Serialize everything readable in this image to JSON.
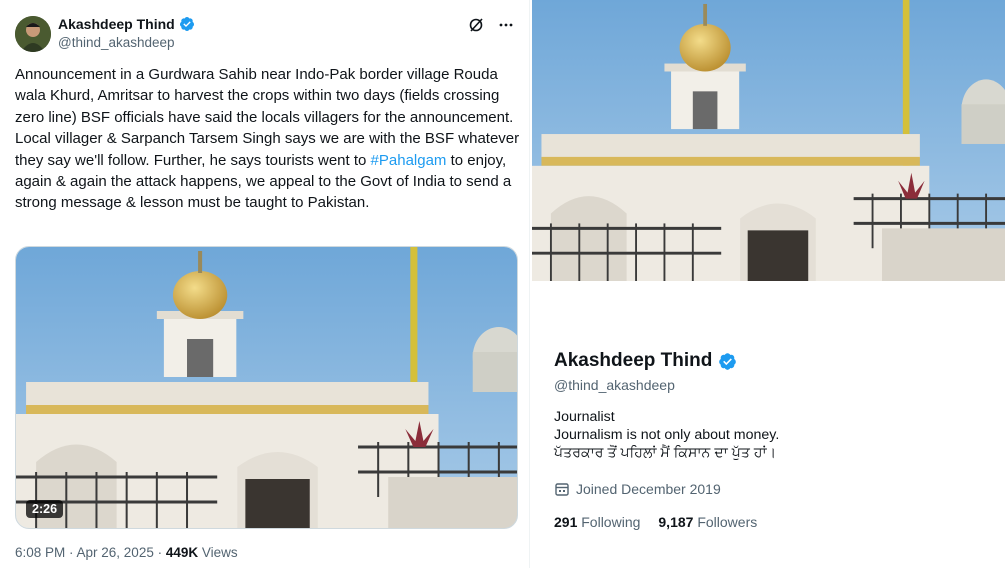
{
  "tweet": {
    "author_name": "Akashdeep Thind",
    "author_handle": "@thind_akashdeep",
    "text_before": "Announcement in a Gurdwara Sahib near Indo-Pak border village Rouda wala Khurd, Amritsar to harvest the crops within two days (fields crossing zero line) BSF officials have said the locals villagers for the announcement. Local villager & Sarpanch Tarsem Singh says we are with the BSF whatever they say we'll follow. Further, he says tourists went to ",
    "hashtag": "#Pahalgam",
    "text_after": " to enjoy, again & again the attack happens, we appeal to the Govt of India to send a strong message & lesson must be taught to Pakistan.",
    "video_duration": "2:26",
    "timestamp": "6:08 PM · Apr 26, 2025 · ",
    "views_count": "449K",
    "views_label": " Views"
  },
  "profile": {
    "name": "Akashdeep Thind",
    "handle": "@thind_akashdeep",
    "bio_line1": "Journalist",
    "bio_line2": "Journalism is not only about money.",
    "bio_line3": "ਪੱਤਰਕਾਰ ਤੋਂ ਪਹਿਲਾਂ ਮੈਂ ਕਿਸਾਨ ਦਾ ਪੁੱਤ ਹਾਂ।",
    "joined": "Joined December 2019",
    "following_count": "291",
    "following_label": "Following",
    "followers_count": "9,187",
    "followers_label": "Followers"
  },
  "colors": {
    "accent": "#1d9bf0",
    "secondary_text": "#536471",
    "sky": "#7fb4e0"
  },
  "icons": [
    "verified-badge-icon",
    "grok-icon",
    "more-icon",
    "calendar-icon"
  ]
}
